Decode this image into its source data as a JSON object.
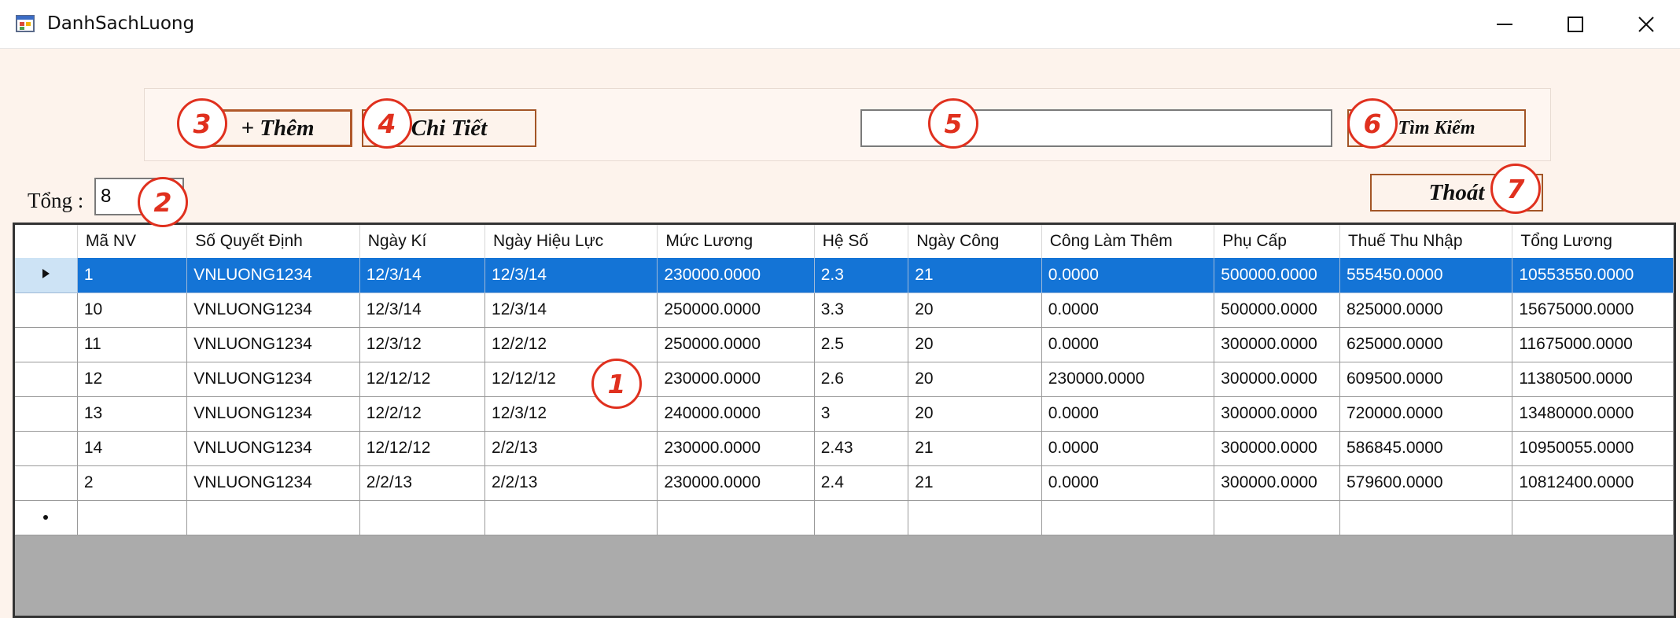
{
  "window": {
    "title": "DanhSachLuong"
  },
  "toolbar": {
    "add_label": "+ Thêm",
    "detail_label": "Chi Tiết",
    "search_value": "",
    "search_label": "Tìm Kiếm",
    "exit_label": "Thoát"
  },
  "total": {
    "label": "Tổng :",
    "value": "8"
  },
  "grid": {
    "columns": [
      "Mã NV",
      "Số Quyết Định",
      "Ngày Kí",
      "Ngày Hiệu Lực",
      "Mức Lương",
      "Hệ Số",
      "Ngày Công",
      "Công Làm Thêm",
      "Phụ Cấp",
      "Thuế Thu Nhập",
      "Tổng Lương"
    ],
    "rows": [
      [
        "1",
        "VNLUONG1234",
        "12/3/14",
        "12/3/14",
        "230000.0000",
        "2.3",
        "21",
        "0.0000",
        "500000.0000",
        "555450.0000",
        "10553550.0000"
      ],
      [
        "10",
        "VNLUONG1234",
        "12/3/14",
        "12/3/14",
        "250000.0000",
        "3.3",
        "20",
        "0.0000",
        "500000.0000",
        "825000.0000",
        "15675000.0000"
      ],
      [
        "11",
        "VNLUONG1234",
        "12/3/12",
        "12/2/12",
        "250000.0000",
        "2.5",
        "20",
        "0.0000",
        "300000.0000",
        "625000.0000",
        "11675000.0000"
      ],
      [
        "12",
        "VNLUONG1234",
        "12/12/12",
        "12/12/12",
        "230000.0000",
        "2.6",
        "20",
        "230000.0000",
        "300000.0000",
        "609500.0000",
        "11380500.0000"
      ],
      [
        "13",
        "VNLUONG1234",
        "12/2/12",
        "12/3/12",
        "240000.0000",
        "3",
        "20",
        "0.0000",
        "300000.0000",
        "720000.0000",
        "13480000.0000"
      ],
      [
        "14",
        "VNLUONG1234",
        "12/12/12",
        "2/2/13",
        "230000.0000",
        "2.43",
        "21",
        "0.0000",
        "300000.0000",
        "586845.0000",
        "10950055.0000"
      ],
      [
        "2",
        "VNLUONG1234",
        "2/2/13",
        "2/2/13",
        "230000.0000",
        "2.4",
        "21",
        "0.0000",
        "300000.0000",
        "579600.0000",
        "10812400.0000"
      ]
    ],
    "selected_row": 0
  },
  "callouts": {
    "grid": "1",
    "total": "2",
    "add": "3",
    "detail": "4",
    "search_box": "5",
    "search": "6",
    "exit": "7"
  },
  "colors": {
    "selection": "#1474d6",
    "form_background": "#fdf3ec",
    "callout": "#e0301e",
    "button_border": "#a35526"
  }
}
